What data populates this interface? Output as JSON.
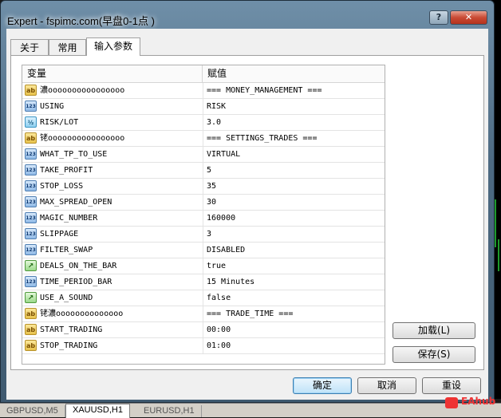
{
  "window": {
    "title": "Expert - fspimc.com(早盘0-1点 )",
    "help_label": "?",
    "close_label": "✕"
  },
  "tabs": [
    {
      "label": "关于"
    },
    {
      "label": "常用"
    },
    {
      "label": "输入参数",
      "active": true
    }
  ],
  "grid": {
    "columns": {
      "variable": "变量",
      "value": "赋值"
    },
    "rows": [
      {
        "icon": "string-type-icon",
        "name": "濃oooooooooooooooo",
        "value": "=== MONEY_MANAGEMENT ==="
      },
      {
        "icon": "integer-type-icon",
        "name": "USING",
        "value": "RISK"
      },
      {
        "icon": "double-type-icon",
        "name": "RISK/LOT",
        "value": "3.0"
      },
      {
        "icon": "string-type-icon",
        "name": "铑oooooooooooooooo",
        "value": "=== SETTINGS_TRADES ==="
      },
      {
        "icon": "integer-type-icon",
        "name": "WHAT_TP_TO_USE",
        "value": "VIRTUAL"
      },
      {
        "icon": "integer-type-icon",
        "name": "TAKE_PROFIT",
        "value": "5"
      },
      {
        "icon": "integer-type-icon",
        "name": "STOP_LOSS",
        "value": "35"
      },
      {
        "icon": "integer-type-icon",
        "name": "MAX_SPREAD_OPEN",
        "value": "30"
      },
      {
        "icon": "integer-type-icon",
        "name": "MAGIC_NUMBER",
        "value": "160000"
      },
      {
        "icon": "integer-type-icon",
        "name": "SLIPPAGE",
        "value": "3"
      },
      {
        "icon": "integer-type-icon",
        "name": "FILTER_SWAP",
        "value": "DISABLED"
      },
      {
        "icon": "boolean-type-icon",
        "name": "DEALS_ON_THE_BAR",
        "value": "true"
      },
      {
        "icon": "integer-type-icon",
        "name": "TIME_PERIOD_BAR",
        "value": "15 Minutes"
      },
      {
        "icon": "boolean-type-icon",
        "name": "USE_A_SOUND",
        "value": "false"
      },
      {
        "icon": "string-type-icon",
        "name": "铑濃oooooooooooooo",
        "value": "=== TRADE_TIME ==="
      },
      {
        "icon": "string-type-icon",
        "name": "START_TRADING",
        "value": "00:00"
      },
      {
        "icon": "string-type-icon",
        "name": "STOP_TRADING",
        "value": "01:00"
      }
    ]
  },
  "icon_labels": {
    "string-type-icon": "ab",
    "integer-type-icon": "123",
    "double-type-icon": "½",
    "boolean-type-icon": "↗"
  },
  "buttons": {
    "load": "加载(L)",
    "save": "保存(S)",
    "ok": "确定",
    "cancel": "取消",
    "reset": "重设"
  },
  "bottom_tabs": [
    {
      "label": "GBPUSD,M5"
    },
    {
      "label": "XAUUSD,H1",
      "active": true
    },
    {
      "label": "EURUSD,H1"
    }
  ],
  "brand": "EAhub"
}
